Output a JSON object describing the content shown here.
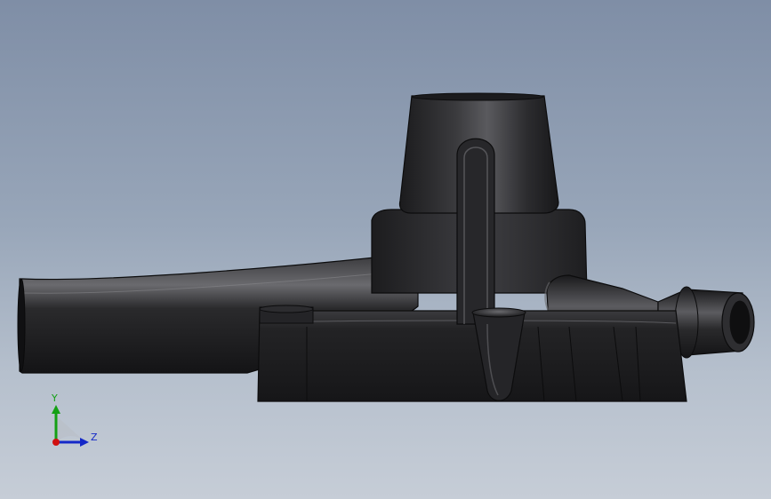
{
  "viewport": {
    "model": "pump-housing-side-view",
    "colors": {
      "background_top": "#7f8ea6",
      "background_bottom": "#c6cdd7",
      "part_body": "#2a2a2c",
      "part_edge": "#0c0c0d",
      "part_highlight": "#8a8a8e"
    }
  },
  "triad": {
    "y_label": "Y",
    "z_label": "Z",
    "colors": {
      "y": "#14a014",
      "z": "#1428c8",
      "x": "#d01010"
    }
  }
}
